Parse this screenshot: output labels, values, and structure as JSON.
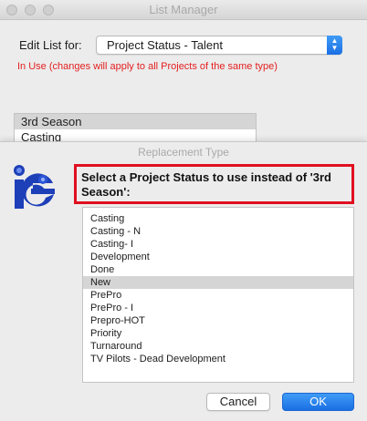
{
  "window": {
    "title": "List Manager"
  },
  "edit_list": {
    "label": "Edit List for:",
    "selected": "Project Status - Talent",
    "note": "In Use (changes will apply to all Projects of the same type)"
  },
  "background_list": {
    "items": [
      "3rd Season",
      "Casting"
    ]
  },
  "sheet": {
    "title": "Replacement Type",
    "logo_text": "iE",
    "prompt": "Select a Project Status to use instead of '3rd Season':",
    "items": [
      "Casting",
      "Casting - N",
      "Casting- I",
      "Development",
      "Done",
      "New",
      "PrePro",
      "PrePro - I",
      "Prepro-HOT",
      "Priority",
      "Turnaround",
      "TV Pilots - Dead Development"
    ],
    "selected_index": 5,
    "cancel_label": "Cancel",
    "ok_label": "OK"
  },
  "colors": {
    "accent": "#1a6fe3",
    "highlight_border": "#e01020",
    "warning_text": "#e32020",
    "selection": "#d5d5d5"
  }
}
